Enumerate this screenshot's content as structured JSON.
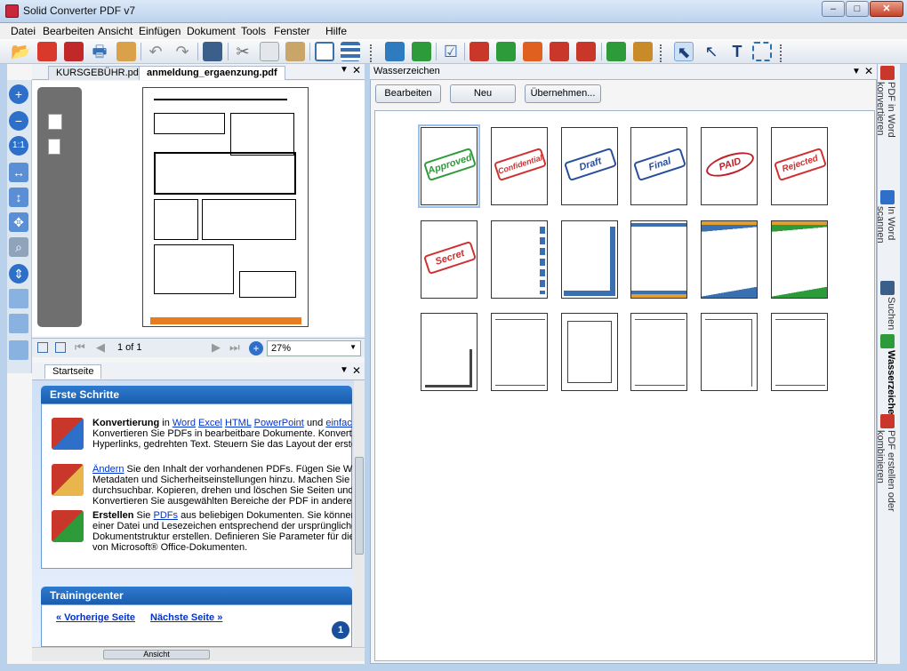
{
  "window": {
    "title": "Solid Converter PDF v7"
  },
  "menu": [
    "Datei",
    "Bearbeiten",
    "Ansicht",
    "Einfügen",
    "Dokument",
    "Tools",
    "Fenster",
    "Hilfe"
  ],
  "doc_tabs": [
    {
      "label": "KURSGEBÜHR.pdf"
    },
    {
      "label": "anmeldung_ergaenzung.pdf"
    }
  ],
  "nav": {
    "page_label": "1 of 1",
    "zoom": "27%"
  },
  "start": {
    "tab": "Startseite",
    "section1_title": "Erste Schritte",
    "item1": {
      "strong": "Konvertierung",
      "in": "in",
      "links": [
        "Word",
        "Excel",
        "HTML",
        "PowerPoint"
      ],
      "und": "und",
      "link_last": "einfachen T",
      "line2": "Konvertieren Sie PDFs in bearbeitbare Dokumente. Konvertieren S",
      "line3": "Hyperlinks, gedrehten Text. Steuern Sie das Layout der erstellten I"
    },
    "item2": {
      "link": "Ändern",
      "line1": "Sie den Inhalt der vorhandenen PDFs. Fügen Sie Wasserz",
      "line2": "Metadaten und Sicherheitseinstellungen hinzu. Machen Sie eine",
      "line3": "durchsuchbar. Kopieren, drehen und löschen Sie Seiten und Obje",
      "line4": "Konvertieren Sie ausgewählten Bereiche der PDF in andere Forma"
    },
    "item3": {
      "strong": "Erstellen",
      "mid": "Sie",
      "link": "PDFs",
      "line1": "aus beliebigen Dokumenten. Sie können eine P",
      "line2": "einer Datei und Lesezeichen entsprechend der ursprünglichen",
      "line3": "Dokumentstruktur erstellen. Definieren Sie Parameter für die Kon",
      "line4": "von Microsoft® Office-Dokumenten."
    },
    "section2_title": "Trainingcenter",
    "prev": "« Vorherige Seite",
    "next": "Nächste Seite »",
    "step": "1"
  },
  "hscroll_label": "Ansicht",
  "watermark": {
    "title": "Wasserzeichen",
    "buttons": [
      "Bearbeiten",
      "Neu",
      "Übernehmen..."
    ],
    "stamps": [
      {
        "text": "Approved",
        "color": "#2e9b3a"
      },
      {
        "text": "Confidential",
        "color": "#d03030"
      },
      {
        "text": "Draft",
        "color": "#284f9c"
      },
      {
        "text": "Final",
        "color": "#284f9c"
      },
      {
        "text": "PAID",
        "color": "#c0202a"
      },
      {
        "text": "Rejected",
        "color": "#d03030"
      },
      {
        "text": "Secret",
        "color": "#d03030"
      }
    ]
  },
  "right_tabs": [
    "PDF in Word konvertieren",
    "In Word scannen",
    "Suchen",
    "Wasserzeichen",
    "PDF erstellen oder kombinieren"
  ]
}
